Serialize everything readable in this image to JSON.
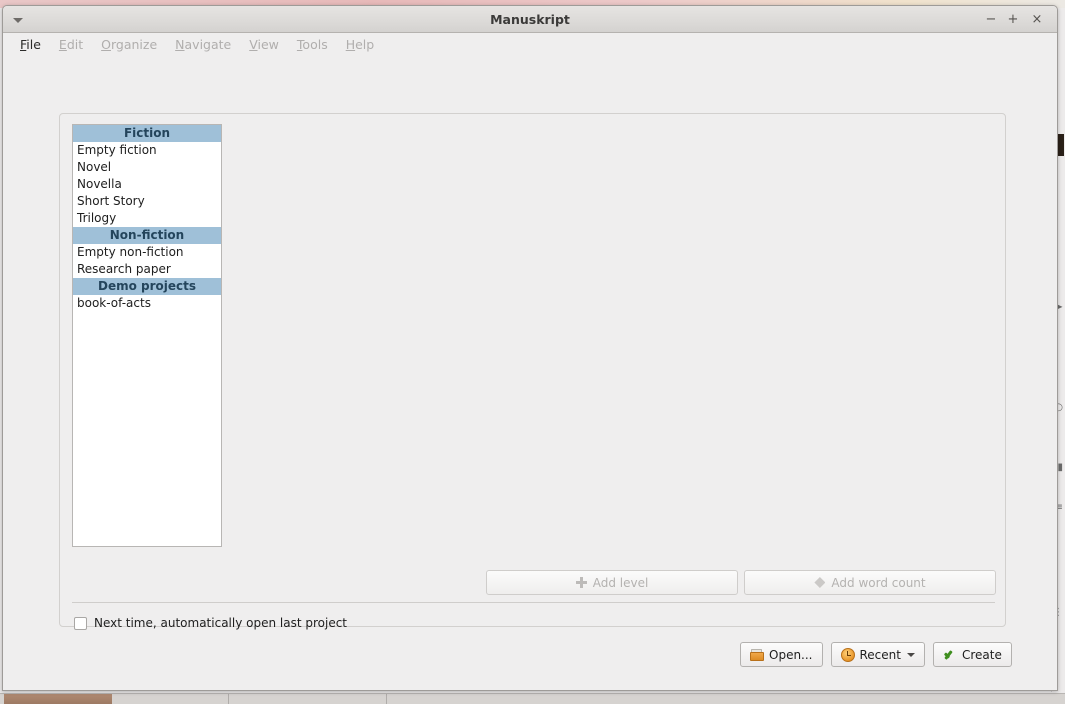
{
  "window": {
    "title": "Manuskript",
    "menu_button_icon": "caret-down-icon",
    "controls": {
      "minimize": "−",
      "maximize": "+",
      "close": "×"
    }
  },
  "menubar": {
    "items": [
      {
        "label": "File",
        "mnemonic": "F",
        "rest": "ile",
        "enabled": true
      },
      {
        "label": "Edit",
        "mnemonic": "E",
        "rest": "dit",
        "enabled": false
      },
      {
        "label": "Organize",
        "mnemonic": "O",
        "rest": "rganize",
        "enabled": false
      },
      {
        "label": "Navigate",
        "mnemonic": "N",
        "rest": "avigate",
        "enabled": false
      },
      {
        "label": "View",
        "mnemonic": "V",
        "rest": "iew",
        "enabled": false
      },
      {
        "label": "Tools",
        "mnemonic": "T",
        "rest": "ools",
        "enabled": false
      },
      {
        "label": "Help",
        "mnemonic": "H",
        "rest": "elp",
        "enabled": false
      }
    ]
  },
  "project_dialog": {
    "template_list": {
      "groups": [
        {
          "header": "Fiction",
          "items": [
            "Empty fiction",
            "Novel",
            "Novella",
            "Short Story",
            "Trilogy"
          ]
        },
        {
          "header": "Non-fiction",
          "items": [
            "Empty non-fiction",
            "Research paper"
          ]
        },
        {
          "header": "Demo projects",
          "items": [
            "book-of-acts"
          ]
        }
      ]
    },
    "level_buttons": [
      {
        "label": "Add level",
        "icon": "plus-icon",
        "enabled": false
      },
      {
        "label": "Add word count",
        "icon": "diamond-icon",
        "enabled": false
      }
    ],
    "auto_open": {
      "label": "Next time, automatically open last project",
      "checked": false
    },
    "actions": [
      {
        "label": "Open...",
        "icon": "folder-icon"
      },
      {
        "label": "Recent",
        "icon": "clock-icon",
        "has_dropdown": true
      },
      {
        "label": "Create",
        "icon": "check-icon"
      }
    ]
  },
  "colors": {
    "list_header_bg": "#9fc0d8",
    "list_header_text": "#24455c",
    "window_bg": "#efeeee",
    "accent_orange": "#e8962a",
    "accent_green": "#3f8e1f"
  }
}
